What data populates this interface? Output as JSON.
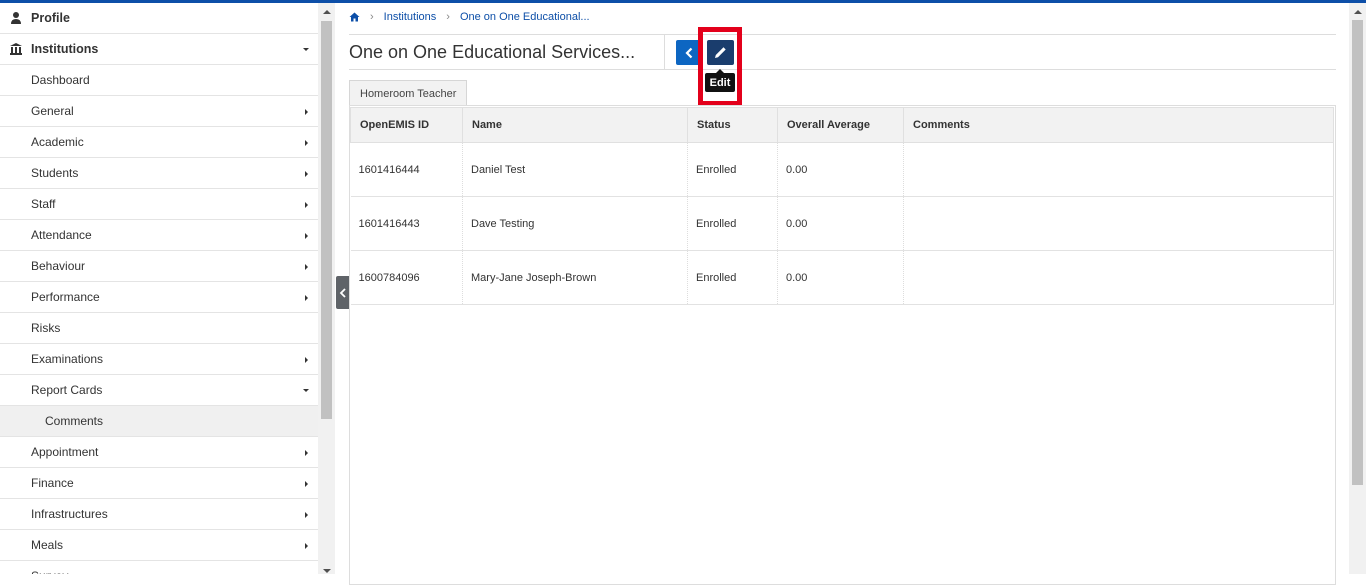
{
  "sidebar": {
    "profile": "Profile",
    "institutions": "Institutions",
    "items": [
      {
        "label": "Dashboard",
        "caret": "none"
      },
      {
        "label": "General",
        "caret": "right"
      },
      {
        "label": "Academic",
        "caret": "right"
      },
      {
        "label": "Students",
        "caret": "right"
      },
      {
        "label": "Staff",
        "caret": "right"
      },
      {
        "label": "Attendance",
        "caret": "right"
      },
      {
        "label": "Behaviour",
        "caret": "right"
      },
      {
        "label": "Performance",
        "caret": "right"
      },
      {
        "label": "Risks",
        "caret": "none"
      },
      {
        "label": "Examinations",
        "caret": "right"
      },
      {
        "label": "Report Cards",
        "caret": "down"
      },
      {
        "label": "Comments",
        "caret": "none",
        "sub": true
      },
      {
        "label": "Appointment",
        "caret": "right"
      },
      {
        "label": "Finance",
        "caret": "right"
      },
      {
        "label": "Infrastructures",
        "caret": "right"
      },
      {
        "label": "Meals",
        "caret": "right"
      },
      {
        "label": "Survey",
        "caret": "right"
      }
    ]
  },
  "breadcrumb": {
    "home_icon": "home-icon",
    "institutions": "Institutions",
    "current": "One on One Educational..."
  },
  "header": {
    "title": "One on One Educational Services...",
    "edit_tooltip": "Edit"
  },
  "tab": {
    "label": "Homeroom Teacher"
  },
  "table": {
    "headers": [
      "OpenEMIS ID",
      "Name",
      "Status",
      "Overall Average",
      "Comments"
    ],
    "rows": [
      [
        "1601416444",
        "Daniel Test",
        "Enrolled",
        "0.00",
        ""
      ],
      [
        "1601416443",
        "Dave Testing",
        "Enrolled",
        "0.00",
        ""
      ],
      [
        "1600784096",
        "Mary-Jane Joseph-Brown",
        "Enrolled",
        "0.00",
        ""
      ]
    ]
  },
  "colors": {
    "brand": "#0d4fa8",
    "back_button": "#0d66c2",
    "edit_button": "#1a3d6d",
    "highlight": "#e3001b"
  }
}
